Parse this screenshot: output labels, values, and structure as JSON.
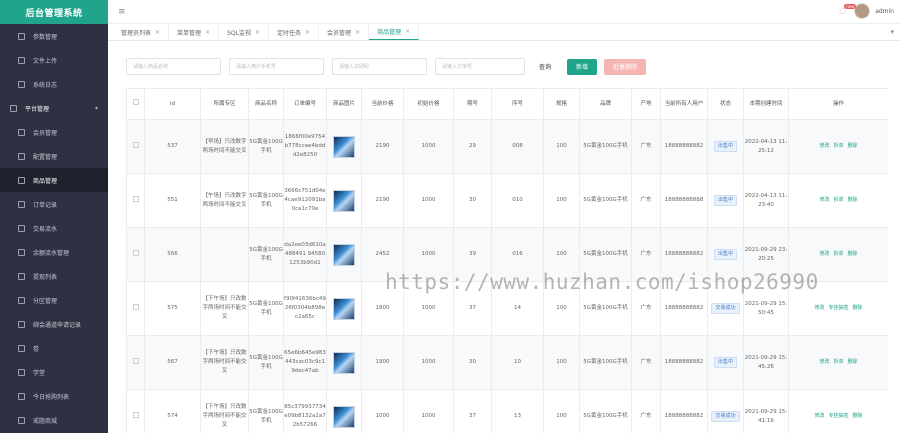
{
  "app_title": "后台管理系统",
  "sidebar": {
    "items": [
      {
        "label": "参数管理",
        "type": "item"
      },
      {
        "label": "文件上传",
        "type": "item"
      },
      {
        "label": "系统日志",
        "type": "item"
      },
      {
        "label": "平台管理",
        "type": "section"
      },
      {
        "label": "会员管理",
        "type": "sub"
      },
      {
        "label": "配置管理",
        "type": "sub"
      },
      {
        "label": "商品管理",
        "type": "sub",
        "active": true
      },
      {
        "label": "订单记录",
        "type": "sub"
      },
      {
        "label": "交易流水",
        "type": "sub"
      },
      {
        "label": "余额流水管理",
        "type": "sub"
      },
      {
        "label": "提现列表",
        "type": "sub"
      },
      {
        "label": "分区管理",
        "type": "sub"
      },
      {
        "label": "绑会通道申请记录",
        "type": "sub"
      },
      {
        "label": "卷",
        "type": "sub"
      },
      {
        "label": "学堂",
        "type": "sub"
      },
      {
        "label": "今日抢购列表",
        "type": "sub"
      },
      {
        "label": "戒脂商城",
        "type": "sub"
      }
    ]
  },
  "header": {
    "hamburger": "≡",
    "badge": "new",
    "user": "admin"
  },
  "tabs": [
    {
      "label": "管理员列表",
      "active": false
    },
    {
      "label": "菜单管理",
      "active": false
    },
    {
      "label": "SQL监视",
      "active": false
    },
    {
      "label": "定时任务",
      "active": false
    },
    {
      "label": "会员管理",
      "active": false
    },
    {
      "label": "商品管理",
      "active": true
    }
  ],
  "filters": {
    "name_placeholder": "请输入商品名称",
    "user_placeholder": "请输入用户手机号",
    "code_placeholder": "请输入识别码",
    "order_placeholder": "请输入订单号",
    "search_label": "查询",
    "add_label": "新增",
    "batch_delete_label": "批量删除"
  },
  "table": {
    "columns": [
      "",
      "id",
      "所属专区",
      "商品名称",
      "订单编号",
      "商品图片",
      "当前价格",
      "初始价格",
      "期号",
      "序号",
      "规格",
      "品牌",
      "产地",
      "当前所有人用户",
      "状态",
      "本期创建时间",
      "操作"
    ],
    "rows": [
      {
        "id": "537",
        "zone": "【早场】只改数字两场时间不能交叉",
        "name": "5G黄金100G手机",
        "order": "1866f00e9754b778ccae4bddd2e8250",
        "price": "2190",
        "init": "1000",
        "period": "29",
        "seq": "008",
        "spec": "100",
        "brand": "5G黄金100G手机",
        "origin": "广东",
        "owner": "18888888882",
        "status": "出售中",
        "time": "2022-04-13 11:25:12",
        "ops": [
          "修改",
          "拆单",
          "删除"
        ]
      },
      {
        "id": "551",
        "zone": "【午场】只改数字两场时间不能交叉",
        "name": "5G黄金100G手机",
        "order": "3666c751d04e4cae912091ba0ca1c70e",
        "price": "2190",
        "init": "1000",
        "period": "30",
        "seq": "010",
        "spec": "100",
        "brand": "5G黄金100G手机",
        "origin": "广东",
        "owner": "18888888888",
        "status": "出售中",
        "time": "2022-04-13 11:23:40",
        "ops": [
          "修改",
          "拆单",
          "删除"
        ]
      },
      {
        "id": "566",
        "zone": "",
        "name": "5G黄金100G手机",
        "order": "da2ee03d610a488491 945801253b90d1",
        "price": "2452",
        "init": "1000",
        "period": "39",
        "seq": "016",
        "spec": "100",
        "brand": "5G黄金100G手机",
        "origin": "广东",
        "owner": "18888888882",
        "status": "出售中",
        "time": "2021-09-29 23:20:25",
        "ops": [
          "修改",
          "拆单",
          "删除"
        ]
      },
      {
        "id": "575",
        "zone": "【下午场】只改数字两场时间不能交叉",
        "name": "5G黄金100G手机",
        "order": "f90f41636bc4926f0304b898ec2a65c",
        "price": "1800",
        "init": "1000",
        "period": "37",
        "seq": "14",
        "spec": "100",
        "brand": "5G黄金100G手机",
        "origin": "广东",
        "owner": "18888888882",
        "status": "交易成功",
        "time": "2021-09-29 15:50:45",
        "ops": [
          "修改",
          "专挂抽签",
          "删除"
        ]
      },
      {
        "id": "567",
        "zone": "【下午场】只改数字两场时间不能交叉",
        "name": "5G黄金100G手机",
        "order": "65e6b645e983443cac03c9c19dec47ab",
        "price": "1900",
        "init": "1000",
        "period": "30",
        "seq": "10",
        "spec": "100",
        "brand": "5G黄金100G手机",
        "origin": "广东",
        "owner": "18888888882",
        "status": "出售中",
        "time": "2021-09-29 15:45:26",
        "ops": [
          "修改",
          "拆单",
          "删除"
        ]
      },
      {
        "id": "574",
        "zone": "【下午场】只改数字两场时间不能交叉",
        "name": "5G黄金100G手机",
        "order": "85c379937734e09b8132a2a72b57266",
        "price": "1000",
        "init": "1000",
        "period": "37",
        "seq": "13",
        "spec": "100",
        "brand": "5G黄金100G手机",
        "origin": "广东",
        "owner": "18888888882",
        "status": "交易成功",
        "time": "2021-09-29 15:41:16",
        "ops": [
          "修改",
          "专挂抽签",
          "删除"
        ]
      }
    ]
  },
  "watermark": "https://www.huzhan.com/ishop26990"
}
